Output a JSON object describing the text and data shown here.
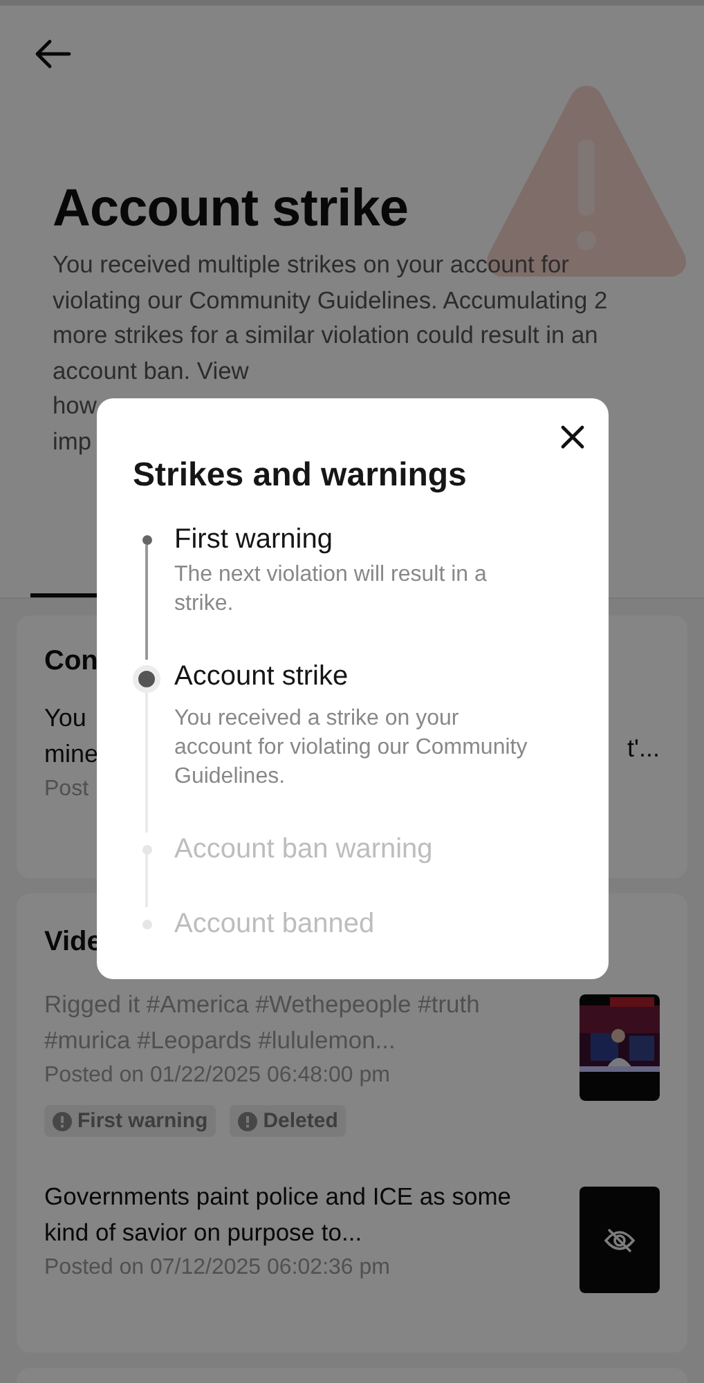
{
  "header": {
    "title": "Account strike",
    "description": "You received multiple strikes on your account for violating our Community Guidelines. Accumulating 2 more strikes for a similar violation could result in an account ban. View",
    "description_fragments": [
      "how",
      "imp"
    ]
  },
  "strike_card": {
    "title_fragment": "Con",
    "body_fragments": [
      "You",
      "mine"
    ],
    "right_fragment": "t'...",
    "posted_fragment": "Post"
  },
  "videos_card": {
    "title_fragment": "Vide",
    "videos": [
      {
        "caption": "Rigged it #America #Wethepeople #truth #murica #Leopards #lululemon...",
        "posted": "Posted on 01/22/2025 06:48:00 pm",
        "removed": true,
        "tags": [
          "First warning",
          "Deleted"
        ]
      },
      {
        "caption": "Governments paint police and ICE as some kind of savior on purpose to...",
        "posted": "Posted on 07/12/2025 06:02:36 pm",
        "removed": false,
        "thumbnail": {
          "kind": "hidden"
        }
      }
    ]
  },
  "modal": {
    "title": "Strikes and warnings",
    "steps": [
      {
        "label": "First warning",
        "description": "The next violation will result in a strike.",
        "reached": true,
        "selected": false
      },
      {
        "label": "Account strike",
        "description": "You received a strike on your account for violating our Community Guidelines.",
        "reached": true,
        "selected": true
      },
      {
        "label": "Account ban warning",
        "reached": false,
        "selected": false
      },
      {
        "label": "Account banned",
        "reached": false,
        "selected": false
      }
    ]
  }
}
